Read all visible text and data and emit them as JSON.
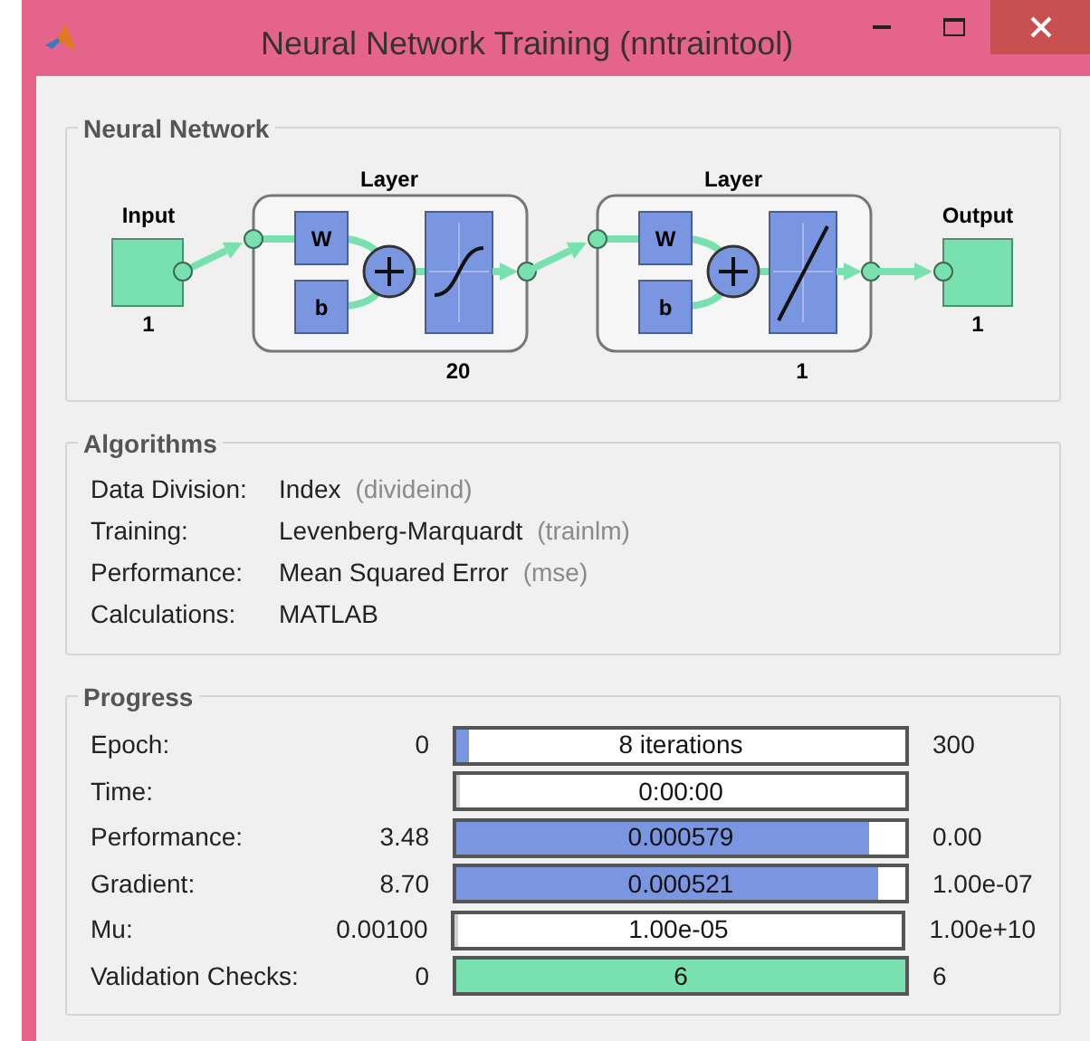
{
  "window": {
    "title": "Neural Network Training (nntraintool)"
  },
  "network": {
    "title": "Neural Network",
    "input": {
      "label": "Input",
      "size": "1"
    },
    "layers": [
      {
        "label": "Layer",
        "size": "20",
        "weight": "W",
        "bias": "b",
        "kind": "sigmoid"
      },
      {
        "label": "Layer",
        "size": "1",
        "weight": "W",
        "bias": "b",
        "kind": "linear"
      }
    ],
    "output": {
      "label": "Output",
      "size": "1"
    }
  },
  "algorithms": {
    "title": "Algorithms",
    "rows": [
      {
        "label": "Data Division:",
        "value": "Index",
        "hint": "(divideind)"
      },
      {
        "label": "Training:",
        "value": "Levenberg-Marquardt",
        "hint": "(trainlm)"
      },
      {
        "label": "Performance:",
        "value": "Mean Squared Error",
        "hint": "(mse)"
      },
      {
        "label": "Calculations:",
        "value": "MATLAB"
      }
    ]
  },
  "progress": {
    "title": "Progress",
    "rows": [
      {
        "label": "Epoch:",
        "start": "0",
        "bar": "8 iterations",
        "level": 0.027,
        "color": "#7b96e0",
        "end": "300"
      },
      {
        "label": "Time:",
        "bar": "0:00:00",
        "level": 0
      },
      {
        "label": "Performance:",
        "start": "3.48",
        "bar": "0.000579",
        "level": 0.92,
        "color": "#7b96e0",
        "end": "0.00"
      },
      {
        "label": "Gradient:",
        "start": "8.70",
        "bar": "0.000521",
        "level": 0.94,
        "color": "#7b96e0",
        "end": "1.00e-07"
      },
      {
        "label": "Mu:",
        "start": "0.00100",
        "bar": "1.00e-05",
        "level": 0,
        "end": "1.00e+10"
      },
      {
        "label": "Validation Checks:",
        "start": "0",
        "bar": "6",
        "level": 1,
        "color": "#79e0b0",
        "end": "6"
      }
    ]
  }
}
